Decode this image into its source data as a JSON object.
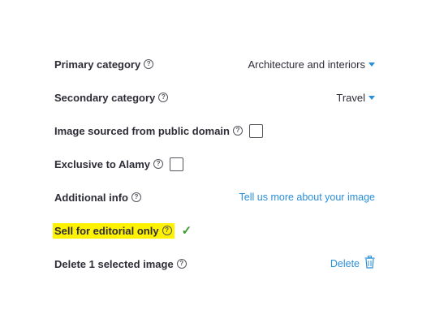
{
  "rows": {
    "primary_category": {
      "label": "Primary category",
      "value": "Architecture and interiors"
    },
    "secondary_category": {
      "label": "Secondary category",
      "value": "Travel"
    },
    "public_domain": {
      "label": "Image sourced from public domain",
      "checked": false
    },
    "exclusive": {
      "label": "Exclusive to Alamy",
      "checked": false
    },
    "additional_info": {
      "label": "Additional info",
      "link": "Tell us more about your image"
    },
    "editorial": {
      "label": "Sell for editorial only",
      "checkmark": "✓"
    },
    "delete": {
      "label": "Delete 1 selected image",
      "action": "Delete"
    }
  },
  "help_glyph": "?",
  "icons": {
    "help": "question-circle-icon",
    "dropdown": "caret-down-icon",
    "check": "checkmark-icon",
    "trash": "trash-icon"
  },
  "colors": {
    "link": "#2a8fd9",
    "highlight": "#fff200",
    "checkmark": "#3b9a2a",
    "text": "#2d2d37"
  }
}
